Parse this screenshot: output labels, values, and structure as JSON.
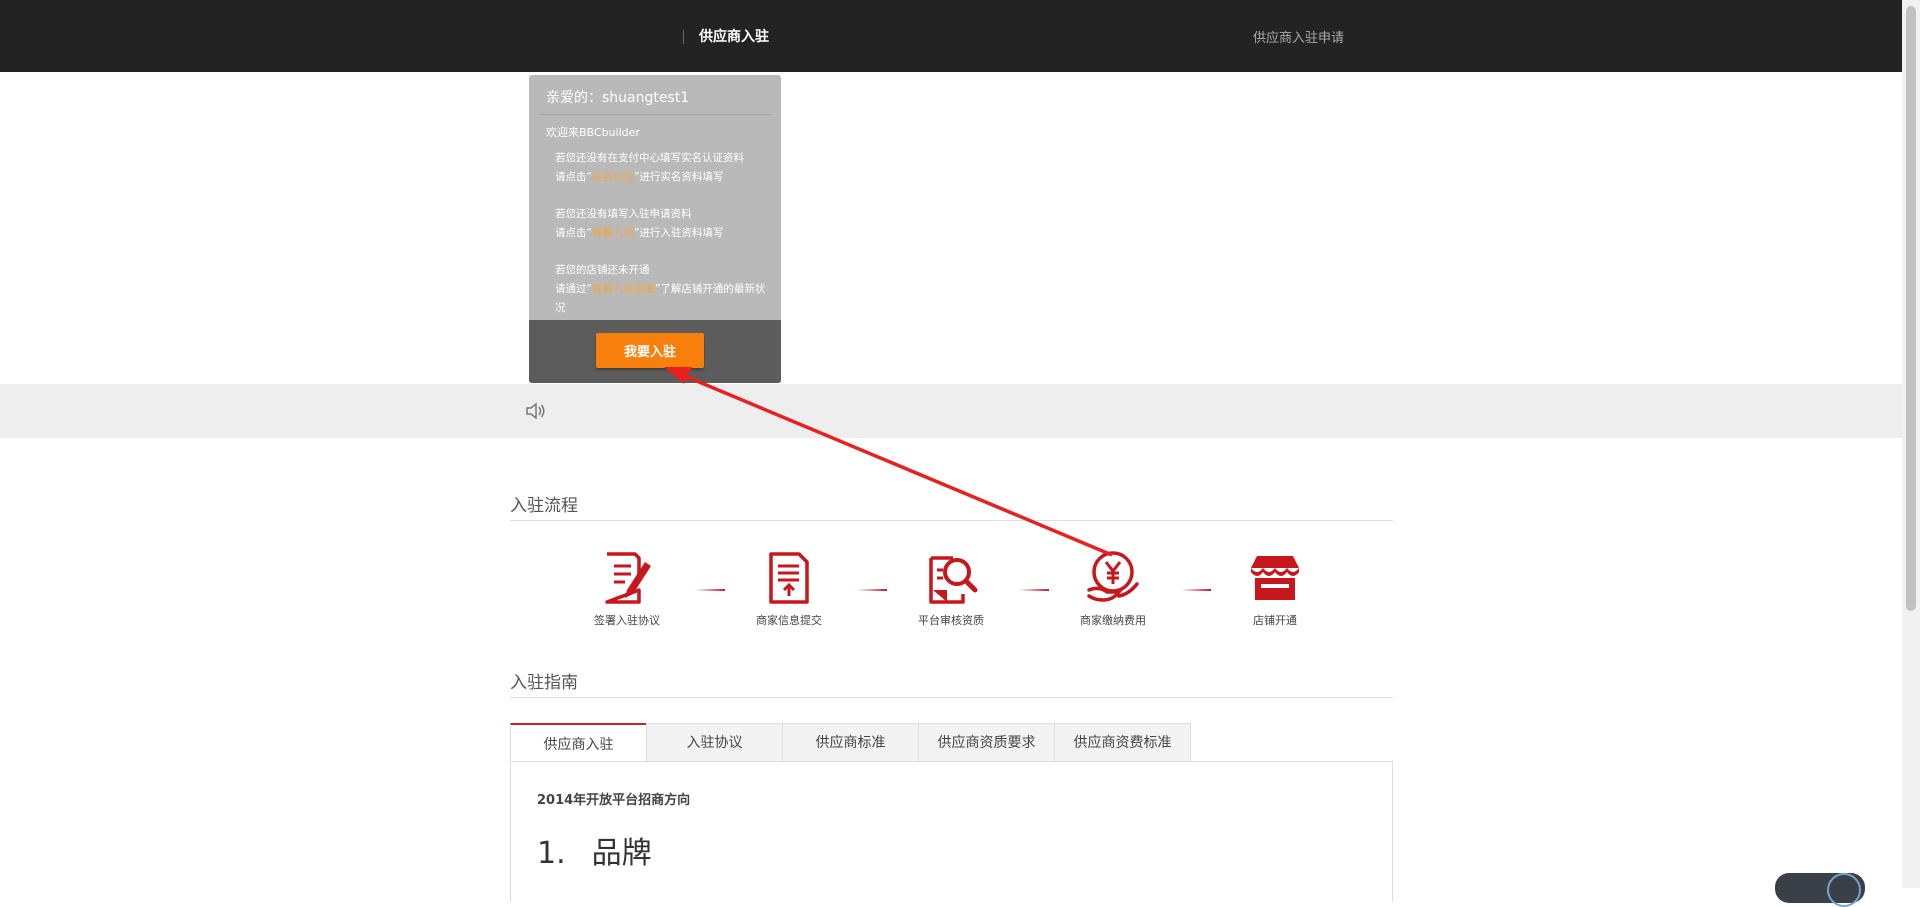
{
  "header": {
    "title": "供应商入驻",
    "apply_link": "供应商入驻申请"
  },
  "popup": {
    "greeting": "亲爱的：shuangtest1",
    "welcome": "欢迎来BBCbuilder",
    "tip1": {
      "line1": "若您还没有在支付中心填写实名认证资料",
      "pre": "请点击“",
      "link": "实名认证",
      "post": "”进行实名资料填写"
    },
    "tip2": {
      "line1": "若您还没有填写入驻申请资料",
      "pre": "请点击“",
      "link": "我要入驻",
      "post": "”进行入驻资料填写"
    },
    "tip3": {
      "line1": "若您的店铺还未开通",
      "pre": "请通过“",
      "link": "查看入驻进度",
      "post": "”了解店铺开通的最新状况"
    },
    "button": "我要入驻"
  },
  "process": {
    "title": "入驻流程",
    "steps": [
      {
        "label": "签署入驻协议",
        "icon": "sign-document-icon"
      },
      {
        "label": "商家信息提交",
        "icon": "upload-document-icon"
      },
      {
        "label": "平台审核资质",
        "icon": "search-document-icon"
      },
      {
        "label": "商家缴纳费用",
        "icon": "yuan-payment-icon"
      },
      {
        "label": "店铺开通",
        "icon": "store-icon"
      }
    ]
  },
  "guide": {
    "title": "入驻指南",
    "tabs": [
      "供应商入驻",
      "入驻协议",
      "供应商标准",
      "供应商资质要求",
      "供应商资费标准"
    ],
    "active_tab": "供应商入驻",
    "subheading": "2014年开放平台招商方向",
    "heading_num": "1.",
    "heading_text": "品牌"
  },
  "colors": {
    "accent_orange": "#f87f0c",
    "icon_red": "#c8161d",
    "topbar": "#232323"
  }
}
